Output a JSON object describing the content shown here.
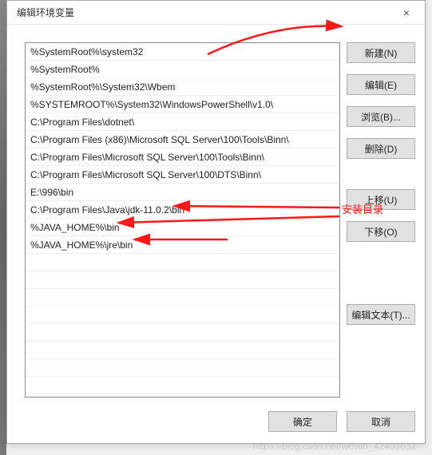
{
  "dialog": {
    "title": "编辑环境变量",
    "close_label": "×"
  },
  "paths": [
    "%SystemRoot%\\system32",
    "%SystemRoot%",
    "%SystemRoot%\\System32\\Wbem",
    "%SYSTEMROOT%\\System32\\WindowsPowerShell\\v1.0\\",
    "C:\\Program Files\\dotnet\\",
    "C:\\Program Files (x86)\\Microsoft SQL Server\\100\\Tools\\Binn\\",
    "C:\\Program Files\\Microsoft SQL Server\\100\\Tools\\Binn\\",
    "C:\\Program Files\\Microsoft SQL Server\\100\\DTS\\Binn\\",
    "E:\\996\\bin",
    "C:\\Program Files\\Java\\jdk-11.0.2\\bin",
    "%JAVA_HOME%\\bin",
    "%JAVA_HOME%\\jre\\bin"
  ],
  "buttons": {
    "new": "新建(N)",
    "edit": "编辑(E)",
    "browse": "浏览(B)...",
    "delete": "删除(D)",
    "move_up": "上移(U)",
    "move_down": "下移(O)",
    "edit_text": "编辑文本(T)...",
    "ok": "确定",
    "cancel": "取消"
  },
  "annotation": {
    "label": "安装目录"
  },
  "watermark": "https://blog.csdn.net/weixin_42403632"
}
